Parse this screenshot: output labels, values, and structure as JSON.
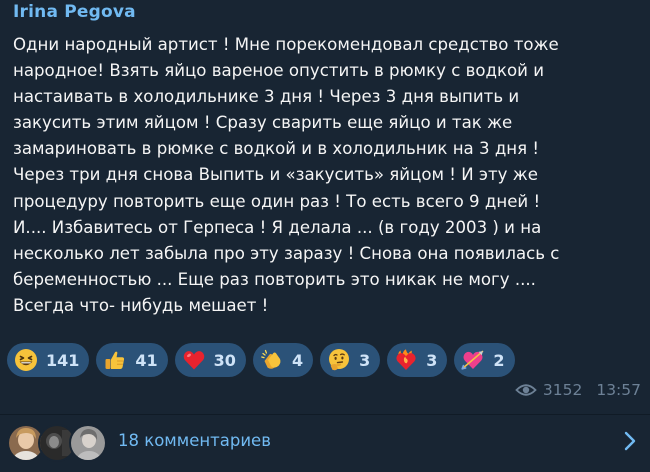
{
  "post": {
    "author": "Irina Pegova",
    "lines": [
      "Одни народный артист ! Мне порекомендовал средство  тоже",
      "народное!   Взять яйцо вареное опустить в рюмку с водкой  и",
      "настаивать  в холодильнике 3 дня ! Через 3 дня выпить и",
      "закусить этим яйцом ! Сразу сварить еще яйцо и так же",
      "замариновать в рюмке с водкой и в холодильник на 3 дня !",
      "Через три дня снова Выпить и «закусить» яйцом ! И эту же",
      "процедуру повторить еще один раз !    То есть всего 9 дней !",
      "И.... Избавитесь от Герпеса !  Я делала ... (в году 2003 ) и на",
      "несколько лет  забыла про эту заразу !  Снова она появилась с",
      "беременностью ...   Еще раз повторить это никак не могу ....",
      "Всегда что- нибудь  мешает !"
    ]
  },
  "reactions": [
    {
      "emoji": "grinning-face",
      "count": "141"
    },
    {
      "emoji": "thumbs-up",
      "count": "41"
    },
    {
      "emoji": "red-heart",
      "count": "30"
    },
    {
      "emoji": "clapping-hands",
      "count": "4"
    },
    {
      "emoji": "thinking-face",
      "count": "3"
    },
    {
      "emoji": "heart-on-fire",
      "count": "3"
    },
    {
      "emoji": "heart-with-arrow",
      "count": "2"
    }
  ],
  "meta": {
    "views": "3152",
    "time": "13:57"
  },
  "comments": {
    "label": "18 комментариев",
    "avatars": [
      "avatar-1",
      "avatar-2",
      "avatar-3"
    ]
  },
  "colors": {
    "background": "#182533",
    "author": "#71baf2",
    "text": "#f5f5f5",
    "reaction_bg": "#2b5278",
    "meta": "#6d8196"
  }
}
